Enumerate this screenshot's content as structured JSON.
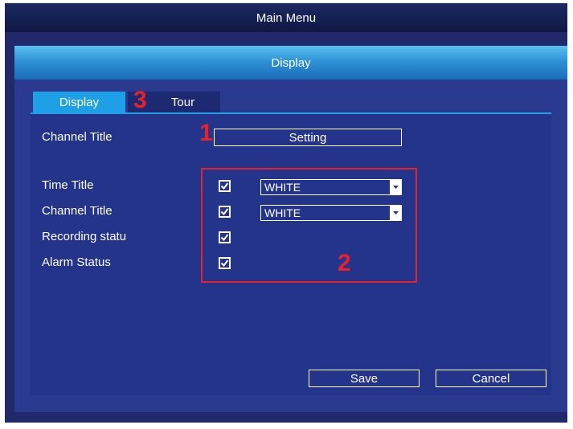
{
  "window": {
    "title": "Main Menu"
  },
  "dialog": {
    "title": "Display",
    "tabs": [
      {
        "label": "Display",
        "active": true
      },
      {
        "label": "Tour",
        "active": false
      }
    ]
  },
  "channel_title_row": {
    "label": "Channel Title",
    "button_label": "Setting"
  },
  "options": [
    {
      "label": "Time Title",
      "checked": true,
      "color_value": "WHITE"
    },
    {
      "label": "Channel Title",
      "checked": true,
      "color_value": "WHITE"
    },
    {
      "label": "Recording statu",
      "checked": true
    },
    {
      "label": "Alarm Status",
      "checked": true
    }
  ],
  "actions": {
    "save_label": "Save",
    "cancel_label": "Cancel"
  },
  "annotations": {
    "marker_1": "1",
    "marker_2": "2",
    "marker_3": "3",
    "annotation_color": "#e8202a"
  },
  "colors": {
    "accent": "#1fa0e6",
    "panel": "#24348a",
    "background": "#22296a"
  }
}
